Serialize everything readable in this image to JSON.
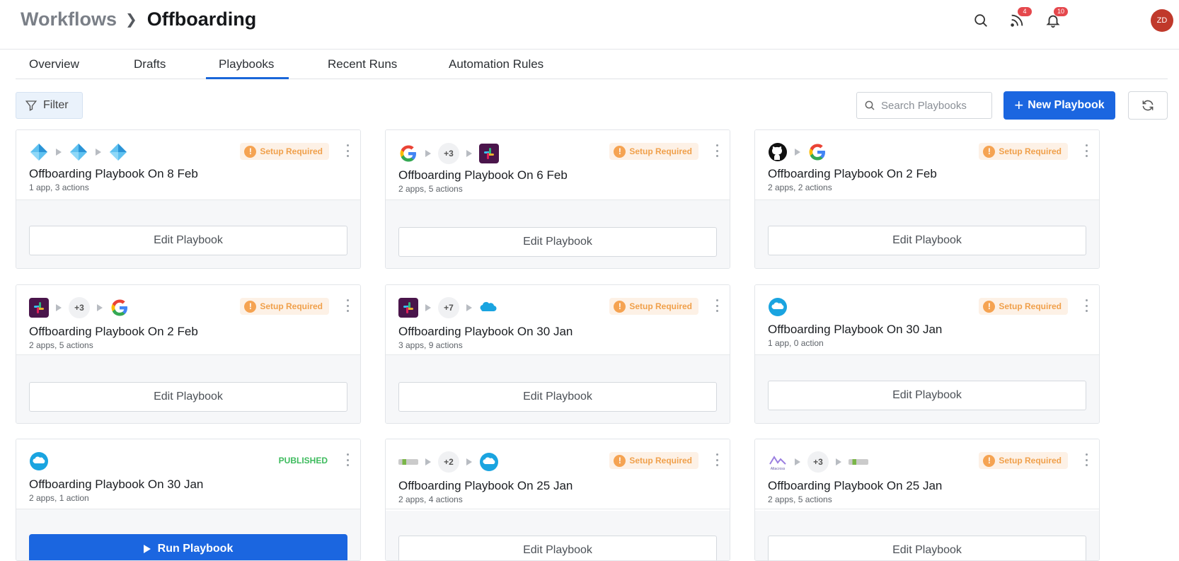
{
  "breadcrumb": {
    "root": "Workflows",
    "current": "Offboarding"
  },
  "header": {
    "feed_badge": "4",
    "notifications_badge": "10",
    "avatar_initials": "ZD"
  },
  "tabs": [
    {
      "label": "Overview"
    },
    {
      "label": "Drafts"
    },
    {
      "label": "Playbooks",
      "active": true
    },
    {
      "label": "Recent Runs"
    },
    {
      "label": "Automation Rules"
    }
  ],
  "toolbar": {
    "filter_label": "Filter",
    "search_placeholder": "Search Playbooks",
    "new_label": "New Playbook"
  },
  "colors": {
    "primary": "#1b66e0",
    "warning": "#f0a04b",
    "published": "#3dbb5d"
  },
  "cards": [
    {
      "title": "Offboarding Playbook On 8 Feb",
      "subtitle": "1 app, 3 actions",
      "status": "Setup Required",
      "action": "Edit Playbook",
      "apps": [
        "azure-ad-icon",
        "azure-ad-icon",
        "azure-ad-icon"
      ]
    },
    {
      "title": "Offboarding Playbook On 6 Feb",
      "subtitle": "2 apps, 5 actions",
      "status": "Setup Required",
      "action": "Edit Playbook",
      "apps": [
        "google-icon",
        "+3",
        "slack-icon"
      ]
    },
    {
      "title": "Offboarding Playbook On 2 Feb",
      "subtitle": "2 apps, 2 actions",
      "status": "Setup Required",
      "action": "Edit Playbook",
      "apps": [
        "github-icon",
        "google-icon"
      ]
    },
    {
      "title": "Offboarding Playbook On 2 Feb",
      "subtitle": "2 apps, 5 actions",
      "status": "Setup Required",
      "action": "Edit Playbook",
      "apps": [
        "slack-icon",
        "+3",
        "google-icon"
      ]
    },
    {
      "title": "Offboarding Playbook On 30 Jan",
      "subtitle": "3 apps, 9 actions",
      "status": "Setup Required",
      "action": "Edit Playbook",
      "apps": [
        "slack-icon",
        "+7",
        "salesforce-icon"
      ]
    },
    {
      "title": "Offboarding Playbook On 30 Jan",
      "subtitle": "1 app, 0 action",
      "status": "Setup Required",
      "action": "Edit Playbook",
      "apps": [
        "salesforce-icon"
      ]
    },
    {
      "title": "Offboarding Playbook On 30 Jan",
      "subtitle": "2 apps, 1 action",
      "status": "PUBLISHED",
      "action": "Run Playbook",
      "apps": [
        "salesforce-icon"
      ]
    },
    {
      "title": "Offboarding Playbook On 25 Jan",
      "subtitle": "2 apps, 4 actions",
      "status": "Setup Required",
      "action": "Edit Playbook",
      "apps": [
        "app-logo-icon",
        "+2",
        "salesforce-icon"
      ]
    },
    {
      "title": "Offboarding Playbook On 25 Jan",
      "subtitle": "2 apps, 5 actions",
      "status": "Setup Required",
      "action": "Edit Playbook",
      "apps": [
        "altacross-icon",
        "+3",
        "app-logo-icon"
      ]
    }
  ]
}
